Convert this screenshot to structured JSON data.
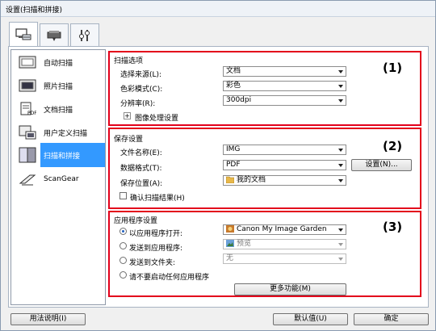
{
  "window": {
    "title": "设置(扫描和拼接)"
  },
  "tabs": [
    {
      "icon": "scan-from-computer-icon"
    },
    {
      "icon": "scan-from-operation-panel-icon"
    },
    {
      "icon": "general-settings-icon"
    }
  ],
  "sidebar": {
    "items": [
      {
        "label": "自动扫描",
        "icon": "auto-scan-icon"
      },
      {
        "label": "照片扫描",
        "icon": "photo-scan-icon"
      },
      {
        "label": "文档扫描",
        "icon": "document-scan-icon"
      },
      {
        "label": "用户定义扫描",
        "icon": "custom-scan-icon"
      },
      {
        "label": "扫描和拼接",
        "icon": "scan-and-stitch-icon",
        "selected": true
      },
      {
        "label": "ScanGear",
        "icon": "scangear-icon"
      }
    ]
  },
  "scan_options": {
    "title": "扫描选项",
    "number": "(1)",
    "source_label": "选择来源(L):",
    "source_value": "文档",
    "color_label": "色彩模式(C):",
    "color_value": "彩色",
    "resolution_label": "分辨率(R):",
    "resolution_value": "300dpi",
    "image_processing_label": "图像处理设置"
  },
  "save_settings": {
    "title": "保存设置",
    "number": "(2)",
    "filename_label": "文件名称(E):",
    "filename_value": "IMG",
    "format_label": "数据格式(T):",
    "format_value": "PDF",
    "format_settings_button": "设置(N)...",
    "location_label": "保存位置(A):",
    "location_value": "我的文档",
    "confirm_label": "确认扫描结果(H)"
  },
  "app_settings": {
    "title": "应用程序设置",
    "number": "(3)",
    "open_with_label": "以应用程序打开:",
    "open_with_value": "Canon My Image Garden",
    "send_to_app_label": "发送到应用程序:",
    "send_to_app_value": "预览",
    "send_to_folder_label": "发送到文件夹:",
    "send_to_folder_value": "无",
    "do_not_start_label": "请不要启动任何应用程序",
    "more_functions_button": "更多功能(M)"
  },
  "footer": {
    "help_button": "用法说明(I)",
    "defaults_button": "默认值(U)",
    "ok_button": "确定"
  },
  "colors": {
    "highlight": "#e3001b",
    "selection": "#3399ff"
  }
}
